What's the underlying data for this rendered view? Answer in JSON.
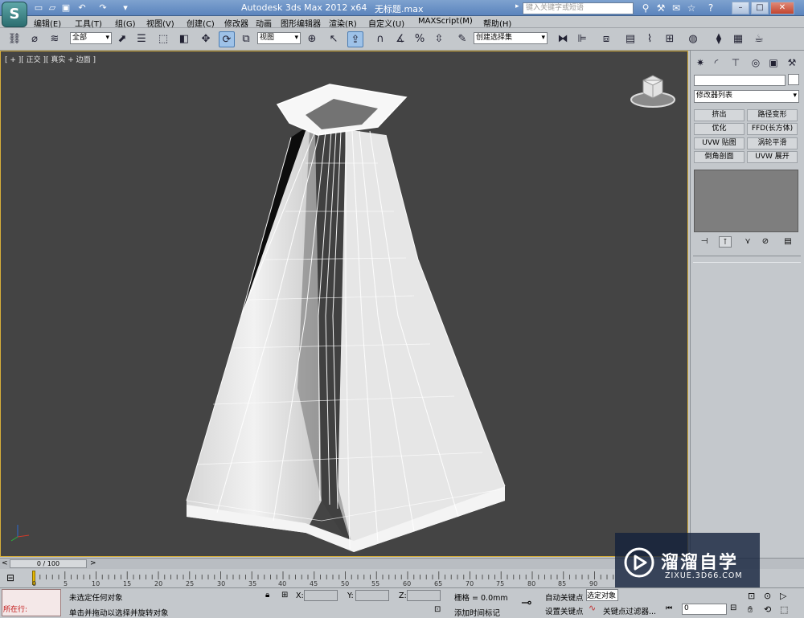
{
  "title_bar": {
    "app_title": "Autodesk 3ds Max  2012 x64",
    "file_name": "无标题.max",
    "search_placeholder": "键入关键字或短语",
    "logo_glyph": "S",
    "window_buttons": [
      "–",
      "□",
      "✕"
    ]
  },
  "menu": [
    "编辑(E)",
    "工具(T)",
    "组(G)",
    "视图(V)",
    "创建(C)",
    "修改器",
    "动画",
    "图形编辑器",
    "渲染(R)",
    "自定义(U)",
    "MAXScript(M)",
    "帮助(H)"
  ],
  "toolbar": {
    "selection_filter": "全部",
    "ref_coord": "视图",
    "named_selection": "创建选择集"
  },
  "viewport": {
    "label": "[ + ][ 正交 ][ 真实 + 边面 ]"
  },
  "command_panel": {
    "modifier_list": "修改器列表",
    "modifier_buttons": [
      "挤出",
      "路径变形",
      "优化",
      "FFD(长方体)",
      "UVW 贴图",
      "涡轮平滑",
      "倒角剖面",
      "UVW 展开"
    ]
  },
  "timeline": {
    "frame_counter": "0 / 100",
    "ticks": [
      "0",
      "5",
      "10",
      "15",
      "20",
      "25",
      "30",
      "35",
      "40",
      "45",
      "50",
      "55",
      "60",
      "65",
      "70",
      "75",
      "80",
      "85",
      "90"
    ]
  },
  "status_bar": {
    "running_label": "所在行:",
    "status_line1": "未选定任何对象",
    "status_line2": "单击并拖动以选择并旋转对象",
    "x_label": "X:",
    "y_label": "Y:",
    "z_label": "Z:",
    "grid": "栅格 = 0.0mm",
    "add_time_tag": "添加时间标记",
    "auto_key": "自动关键点",
    "set_key": "设置关键点",
    "selected_object": "选定对象",
    "key_filters": "关键点过滤器...",
    "frame_value": "0"
  },
  "watermark": {
    "title": "溜溜自学",
    "subtitle": "ZIXUE.3D66.COM"
  }
}
